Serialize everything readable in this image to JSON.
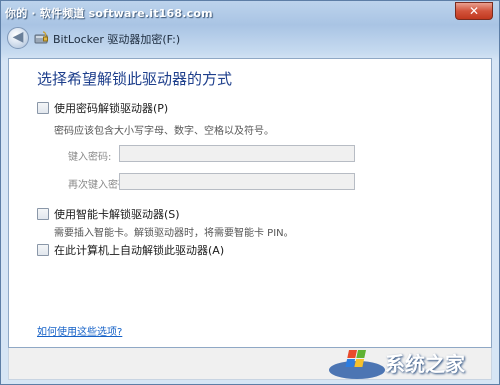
{
  "watermark": "你的 · 软件频道 software.it168.com",
  "window": {
    "title": "BitLocker 驱动器加密(F:)",
    "close_glyph": "✕",
    "back_glyph": "◀"
  },
  "content": {
    "heading": "选择希望解锁此驱动器的方式",
    "options": [
      {
        "label": "使用密码解锁驱动器(P)",
        "checked": false
      },
      {
        "label": "使用智能卡解锁驱动器(S)",
        "checked": false
      },
      {
        "label": "在此计算机上自动解锁此驱动器(A)",
        "checked": false
      }
    ],
    "password_hint": "密码应该包含大小写字母、数字、空格以及符号。",
    "password_label": "键入密码:",
    "confirm_label": "再次键入密码:",
    "password_value": "",
    "confirm_value": "",
    "smartcard_hint": "需要插入智能卡。解锁驱动器时，将需要智能卡 PIN。",
    "help_link": "如何使用这些选项?"
  },
  "logo": {
    "text": "系统之家",
    "icon": "windows-logo-icon"
  }
}
